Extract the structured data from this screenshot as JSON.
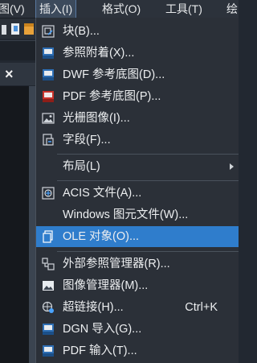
{
  "menubar": {
    "items": [
      {
        "label": "图(V)"
      },
      {
        "label": "插入(I)"
      },
      {
        "label": "格式(O)"
      },
      {
        "label": "工具(T)"
      },
      {
        "label": "绘"
      }
    ]
  },
  "menu": {
    "items": [
      {
        "label": "块(B)...",
        "icon": "block-icon"
      },
      {
        "label": "参照附着(X)...",
        "icon": "dwg-attach-icon"
      },
      {
        "label": "DWF 参考底图(D)...",
        "icon": "dwf-underlay-icon"
      },
      {
        "label": "PDF 参考底图(P)...",
        "icon": "pdf-underlay-icon"
      },
      {
        "label": "光栅图像(I)...",
        "icon": "raster-image-icon"
      },
      {
        "label": "字段(F)...",
        "icon": "field-icon"
      },
      {
        "label": "布局(L)",
        "icon": "",
        "submenu": true
      },
      {
        "label": "ACIS 文件(A)...",
        "icon": "acis-file-icon"
      },
      {
        "label": "Windows 图元文件(W)...",
        "icon": ""
      },
      {
        "label": "OLE 对象(O)...",
        "icon": "ole-object-icon",
        "highlighted": true
      },
      {
        "label": "外部参照管理器(R)...",
        "icon": "xref-manager-icon"
      },
      {
        "label": "图像管理器(M)...",
        "icon": "image-manager-icon"
      },
      {
        "label": "超链接(H)...",
        "icon": "hyperlink-icon",
        "shortcut": "Ctrl+K"
      },
      {
        "label": "DGN 导入(G)...",
        "icon": "dgn-import-icon"
      },
      {
        "label": "PDF 输入(T)...",
        "icon": "pdf-import-icon"
      }
    ]
  },
  "colors": {
    "menu_bg": "#2b3038",
    "highlight": "#2f7dcc",
    "text": "#eceef0"
  }
}
